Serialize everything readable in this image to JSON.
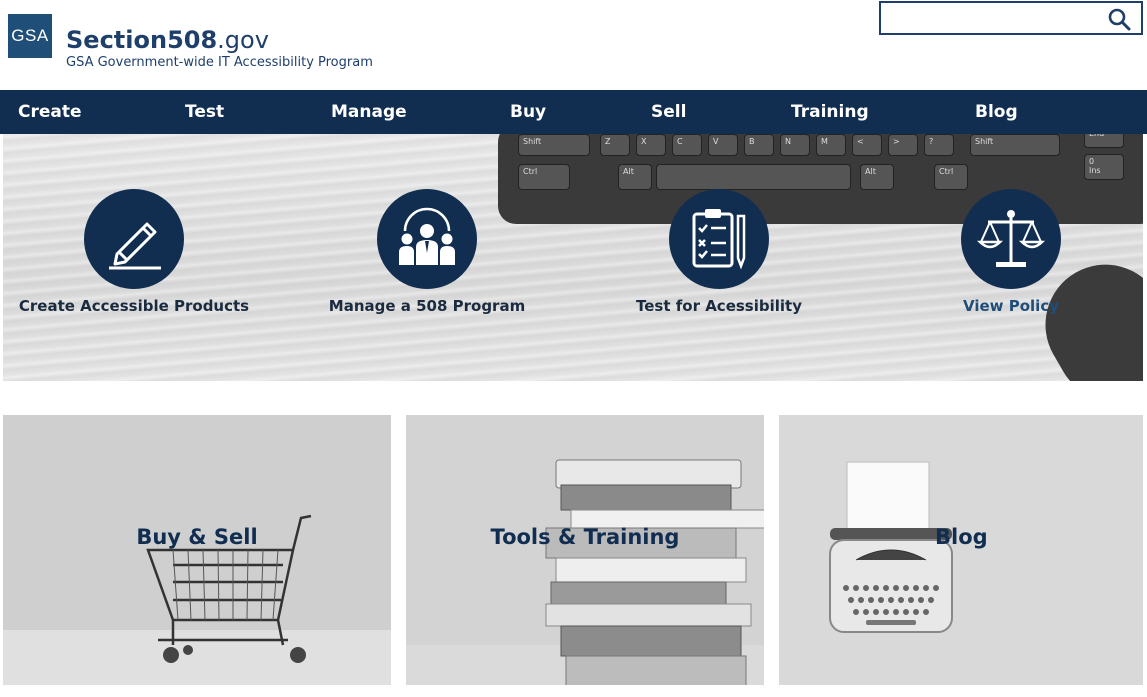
{
  "header": {
    "logo_text": "GSA",
    "site_name_bold": "Section508",
    "site_name_suffix": ".gov",
    "subtitle": "GSA Government-wide IT Accessibility Program"
  },
  "search": {
    "value": "",
    "placeholder": "",
    "icon": "search-icon"
  },
  "nav": {
    "items": [
      {
        "label": "Create"
      },
      {
        "label": "Test"
      },
      {
        "label": "Manage"
      },
      {
        "label": "Buy"
      },
      {
        "label": "Sell"
      },
      {
        "label": "Training"
      },
      {
        "label": "Blog"
      }
    ]
  },
  "hero": {
    "keyboard_keys": [
      "Shift",
      "Z",
      "X",
      "C",
      "V",
      "B",
      "N",
      "M",
      "<",
      ">",
      "?",
      "Shift",
      "Ctrl",
      "Alt",
      "Alt",
      "Ctrl",
      "Ins",
      "0",
      "End"
    ],
    "features": [
      {
        "label": "Create Accessible Products",
        "icon": "pencil-icon"
      },
      {
        "label": "Manage a 508 Program",
        "icon": "team-icon"
      },
      {
        "label": "Test for Acessibility",
        "icon": "checklist-icon"
      },
      {
        "label": "View Policy",
        "icon": "scales-icon"
      }
    ]
  },
  "tiles": [
    {
      "title": "Buy & Sell",
      "image": "shopping-cart"
    },
    {
      "title": "Tools & Training",
      "image": "book-stack"
    },
    {
      "title": "Blog",
      "image": "typewriter"
    }
  ],
  "colors": {
    "navy": "#112e51",
    "brand_blue": "#1f4e79",
    "white": "#ffffff"
  }
}
